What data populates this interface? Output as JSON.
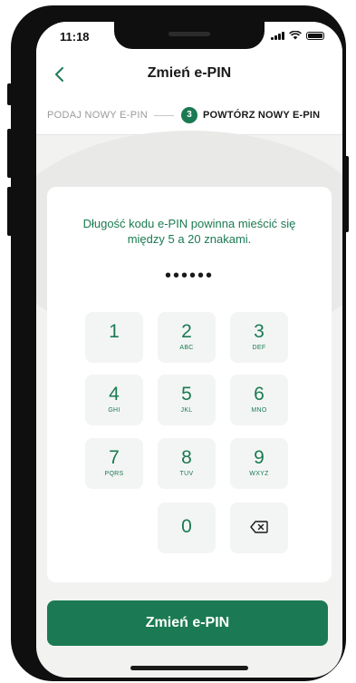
{
  "status_bar": {
    "time": "11:18"
  },
  "header": {
    "back_icon": "chevron-left-icon",
    "title": "Zmień e-PIN"
  },
  "steps": {
    "previous": "PODAJ NOWY E-PIN",
    "current_number": "3",
    "current": "POWTÓRZ NOWY E-PIN"
  },
  "pin_entry": {
    "hint": "Długość kodu e-PIN powinna mieścić się między 5 a 20 znakami.",
    "masked_value": "••••••"
  },
  "keypad": {
    "keys": [
      {
        "digit": "1",
        "letters": ""
      },
      {
        "digit": "2",
        "letters": "ABC"
      },
      {
        "digit": "3",
        "letters": "DEF"
      },
      {
        "digit": "4",
        "letters": "GHI"
      },
      {
        "digit": "5",
        "letters": "JKL"
      },
      {
        "digit": "6",
        "letters": "MNO"
      },
      {
        "digit": "7",
        "letters": "PQRS"
      },
      {
        "digit": "8",
        "letters": "TUV"
      },
      {
        "digit": "9",
        "letters": "WXYZ"
      },
      {
        "digit": "0",
        "letters": ""
      }
    ],
    "backspace_icon": "backspace-icon"
  },
  "submit_button": {
    "label": "Zmień e-PIN"
  },
  "colors": {
    "accent": "#1b7a53",
    "background": "#f2f3f1",
    "key_background": "#f3f5f4"
  }
}
